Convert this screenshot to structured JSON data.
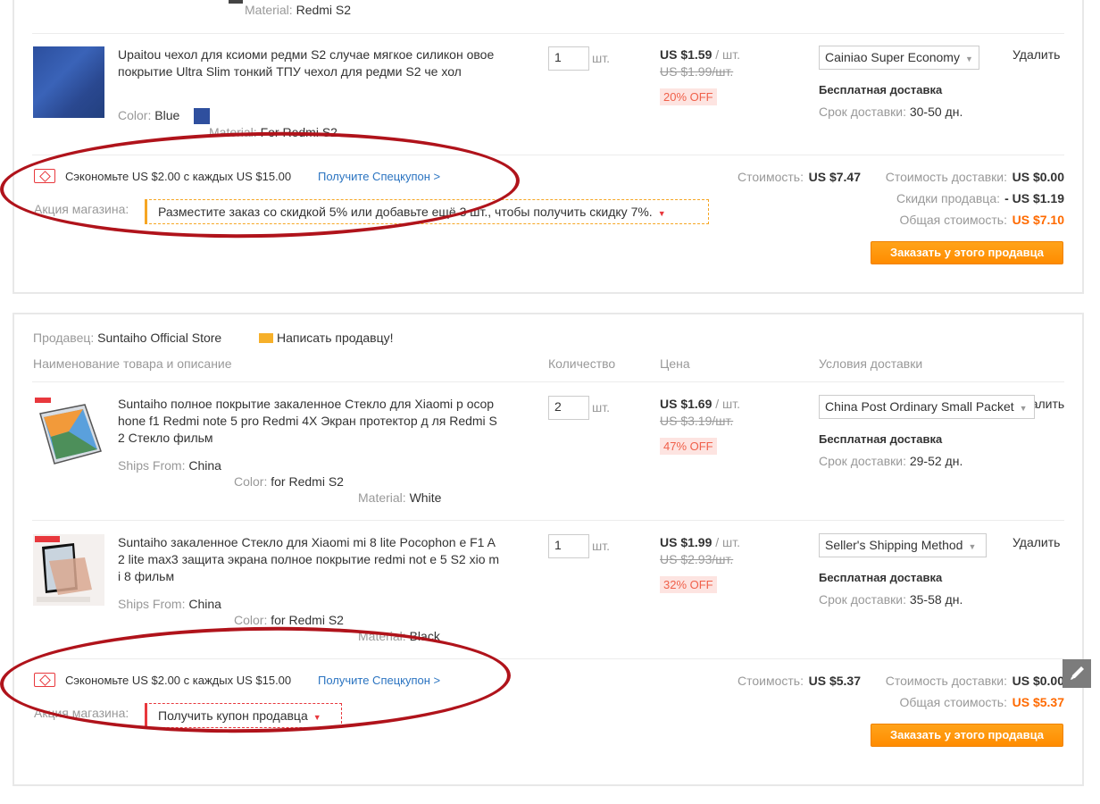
{
  "store1": {
    "prev_material": {
      "label": "Material:",
      "value": "Redmi S2"
    },
    "item": {
      "title": "Upaitou чехол для ксиоми редми S2 случае мягкое силикон овое покрытие Ultra Slim тонкий ТПУ чехол для редми S2 че хол",
      "color_label": "Color:",
      "color_value": "Blue",
      "material_label": "Material:",
      "material_value": "For Redmi S2",
      "qty": "1",
      "unit": "шт.",
      "price": "US $1.59",
      "per": "/ шт.",
      "old_price": "US $1.99/шт.",
      "discount": "20% OFF",
      "shipping": "Cainiao Super Economy",
      "free_shipping": "Бесплатная доставка",
      "delivery_label": "Срок доставки:",
      "delivery_value": "30-50 дн.",
      "delete": "Удалить",
      "swatch_color": "#2f4f9e"
    },
    "save_text": "Сэкономьте US $2.00 с каждых US $15.00",
    "coupon_link": "Получите Спецкупон >",
    "promo_label": "Акция магазина:",
    "promo_text": "Разместите заказ со скидкой 5% или добавьте ещё 3 шт., чтобы получить скидку 7%.",
    "cost_label": "Стоимость:",
    "cost_value": "US $7.47",
    "shipcost_label": "Стоимость доставки:",
    "shipcost_value": "US $0.00",
    "seller_discount_label": "Скидки продавца:",
    "seller_discount_value": "- US $1.19",
    "total_label": "Общая стоимость:",
    "total_value": "US $7.10",
    "order_button": "Заказать у этого продавца"
  },
  "store2": {
    "seller_label": "Продавец:",
    "seller_name": "Suntaiho Official Store",
    "message_seller": "Написать продавцу!",
    "headers": {
      "product": "Наименование товара и описание",
      "quantity": "Количество",
      "price": "Цена",
      "shipping": "Условия доставки"
    },
    "items": [
      {
        "title": "Suntaiho полное покрытие закаленное Стекло для Xiaomi р ocophone f1 Redmi note 5 pro Redmi 4X Экран протектор д ля Redmi S2 Стекло фильм",
        "ships_label": "Ships From:",
        "ships_value": "China",
        "color_label": "Color:",
        "color_value": "for Redmi S2",
        "material_label": "Material:",
        "material_value": "White",
        "qty": "2",
        "unit": "шт.",
        "price": "US $1.69",
        "per": "/ шт.",
        "old_price": "US $3.19/шт.",
        "discount": "47% OFF",
        "shipping": "China Post Ordinary Small Packet",
        "free_shipping": "Бесплатная доставка",
        "delivery_label": "Срок доставки:",
        "delivery_value": "29-52 дн.",
        "delete": "удалить"
      },
      {
        "title": "Suntaiho закаленное Стекло для Xiaomi mi 8 lite Pocophon e F1 A2 lite max3 защита экрана полное покрытие redmi not e 5 S2 xio mi 8 фильм",
        "ships_label": "Ships From:",
        "ships_value": "China",
        "color_label": "Color:",
        "color_value": "for Redmi S2",
        "material_label": "Material:",
        "material_value": "Black",
        "qty": "1",
        "unit": "шт.",
        "price": "US $1.99",
        "per": "/ шт.",
        "old_price": "US $2.93/шт.",
        "discount": "32% OFF",
        "shipping": "Seller's Shipping Method",
        "free_shipping": "Бесплатная доставка",
        "delivery_label": "Срок доставки:",
        "delivery_value": "35-58 дн.",
        "delete": "Удалить"
      }
    ],
    "save_text": "Сэкономьте US $2.00 с каждых US $15.00",
    "coupon_link": "Получите Спецкупон >",
    "promo_label": "Акция магазина:",
    "promo_text": "Получить купон продавца",
    "cost_label": "Стоимость:",
    "cost_value": "US $5.37",
    "shipcost_label": "Стоимость доставки:",
    "shipcost_value": "US $0.00",
    "total_label": "Общая стоимость:",
    "total_value": "US $5.37",
    "order_button": "Заказать у этого продавца"
  },
  "colors": {
    "accent_orange": "#ff6a00",
    "link_blue": "#2b74c1",
    "annotation_red": "#b0131b",
    "discount_bg": "#fde4e1"
  }
}
